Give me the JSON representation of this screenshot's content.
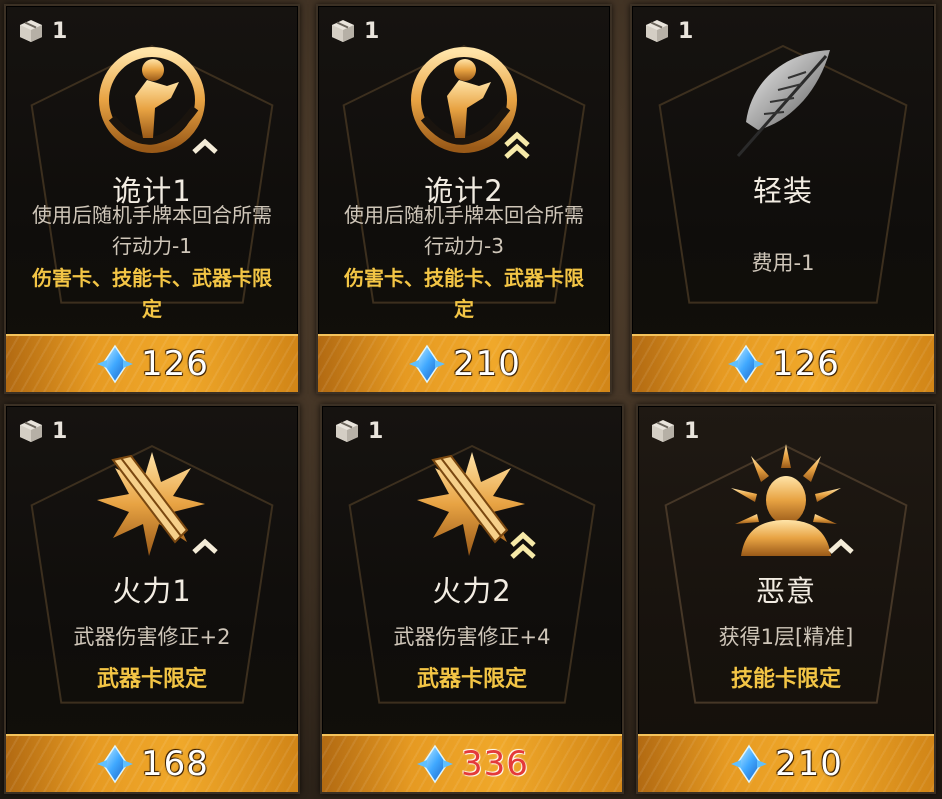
{
  "colors": {
    "gold_text": "#f3c545",
    "price_bar": "#e69a22",
    "price_red": "#e43a3a",
    "gem": "#3fa8ff"
  },
  "cards": [
    {
      "quantity": "1",
      "icon": "trick-icon",
      "rank": "single-chevron-icon",
      "title": "诡计1",
      "desc": [
        "使用后随机手牌本回合所需",
        "行动力-1"
      ],
      "limit": [
        "伤害卡、技能卡、武器卡限",
        "定"
      ],
      "price": "126",
      "price_affordable": true
    },
    {
      "quantity": "1",
      "icon": "trick-icon",
      "rank": "double-chevron-icon",
      "title": "诡计2",
      "desc": [
        "使用后随机手牌本回合所需",
        "行动力-3"
      ],
      "limit": [
        "伤害卡、技能卡、武器卡限",
        "定"
      ],
      "price": "210",
      "price_affordable": true
    },
    {
      "quantity": "1",
      "icon": "feather-icon",
      "rank": "",
      "title": "轻装",
      "desc": [
        "费用-1"
      ],
      "limit": [],
      "price": "126",
      "price_affordable": true
    },
    {
      "quantity": "1",
      "icon": "firepower-icon",
      "rank": "single-chevron-icon",
      "title": "火力1",
      "desc": [
        "武器伤害修正+2"
      ],
      "limit": [
        "武器卡限定"
      ],
      "price": "168",
      "price_affordable": true
    },
    {
      "quantity": "1",
      "icon": "firepower-icon",
      "rank": "double-chevron-icon",
      "title": "火力2",
      "desc": [
        "武器伤害修正+4"
      ],
      "limit": [
        "武器卡限定"
      ],
      "price": "336",
      "price_affordable": false
    },
    {
      "quantity": "1",
      "icon": "malice-icon",
      "rank": "single-chevron-icon",
      "title": "恶意",
      "desc": [
        "获得1层[精准]"
      ],
      "limit": [
        "技能卡限定"
      ],
      "price": "210",
      "price_affordable": true
    }
  ]
}
